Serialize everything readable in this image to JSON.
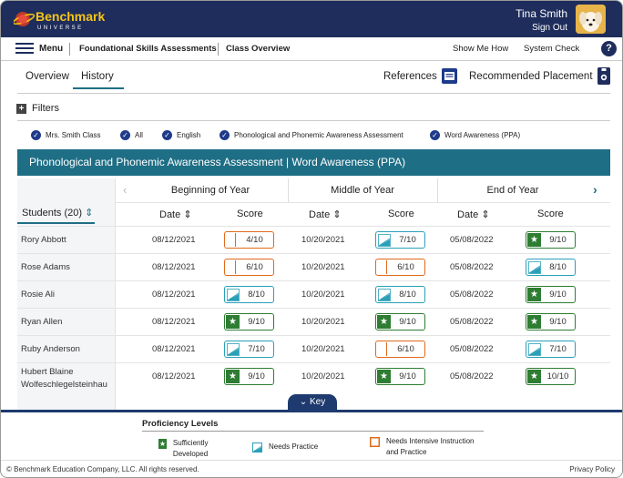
{
  "brand": {
    "name": "Benchmark",
    "sub": "UNIVERSE"
  },
  "user": {
    "name": "Tina Smith",
    "sign_out": "Sign Out"
  },
  "nav": {
    "menu": "Menu",
    "foundational": "Foundational Skills Assessments",
    "class_overview": "Class Overview",
    "show_me_how": "Show Me How",
    "system_check": "System Check",
    "help": "?"
  },
  "tabs": {
    "overview": "Overview",
    "history": "History"
  },
  "actions": {
    "references": "References",
    "recommended": "Recommended Placement"
  },
  "filters": {
    "label": "Filters",
    "chips": [
      "Mrs. Smith Class",
      "All",
      "English",
      "Phonological and Phonemic Awareness Assessment",
      "Word Awareness (PPA)"
    ]
  },
  "table": {
    "title": "Phonological and Phonemic Awareness Assessment | Word Awareness (PPA)",
    "periods": [
      "Beginning of Year",
      "Middle of Year",
      "End of Year"
    ],
    "students_label": "Students",
    "students_count": "(20)",
    "date_label": "Date",
    "score_label": "Score",
    "rows": [
      {
        "name": "Rory Abbott",
        "cells": [
          {
            "date": "08/12/2021",
            "score": "4/10",
            "level": "intense"
          },
          {
            "date": "10/20/2021",
            "score": "7/10",
            "level": "prac"
          },
          {
            "date": "05/08/2022",
            "score": "9/10",
            "level": "good"
          }
        ]
      },
      {
        "name": "Rose Adams",
        "cells": [
          {
            "date": "08/12/2021",
            "score": "6/10",
            "level": "intense"
          },
          {
            "date": "10/20/2021",
            "score": "6/10",
            "level": "intense"
          },
          {
            "date": "05/08/2022",
            "score": "8/10",
            "level": "prac"
          }
        ]
      },
      {
        "name": "Rosie Ali",
        "cells": [
          {
            "date": "08/12/2021",
            "score": "8/10",
            "level": "prac"
          },
          {
            "date": "10/20/2021",
            "score": "8/10",
            "level": "prac"
          },
          {
            "date": "05/08/2022",
            "score": "9/10",
            "level": "good"
          }
        ]
      },
      {
        "name": "Ryan Allen",
        "cells": [
          {
            "date": "08/12/2021",
            "score": "9/10",
            "level": "good"
          },
          {
            "date": "10/20/2021",
            "score": "9/10",
            "level": "good"
          },
          {
            "date": "05/08/2022",
            "score": "9/10",
            "level": "good"
          }
        ]
      },
      {
        "name": "Ruby Anderson",
        "cells": [
          {
            "date": "08/12/2021",
            "score": "7/10",
            "level": "prac"
          },
          {
            "date": "10/20/2021",
            "score": "6/10",
            "level": "intense"
          },
          {
            "date": "05/08/2022",
            "score": "7/10",
            "level": "prac"
          }
        ]
      },
      {
        "name": "Hubert Blaine Wolfeschlegelsteinhau",
        "cells": [
          {
            "date": "08/12/2021",
            "score": "9/10",
            "level": "good"
          },
          {
            "date": "10/20/2021",
            "score": "9/10",
            "level": "good"
          },
          {
            "date": "05/08/2022",
            "score": "10/10",
            "level": "good"
          }
        ]
      }
    ]
  },
  "key_label": "Key",
  "legend": {
    "title": "Proficiency Levels",
    "good": "Sufficiently Developed",
    "prac": "Needs Practice",
    "intense": "Needs Intensive Instruction and Practice"
  },
  "footer": {
    "copyright": "© Benchmark Education Company, LLC. All rights reserved.",
    "privacy": "Privacy Policy"
  },
  "colors": {
    "navy": "#1e2d5c",
    "teal": "#1e6e85",
    "green": "#2e7d32",
    "practice": "#2aa0b8",
    "intensive": "#e06a1b"
  }
}
